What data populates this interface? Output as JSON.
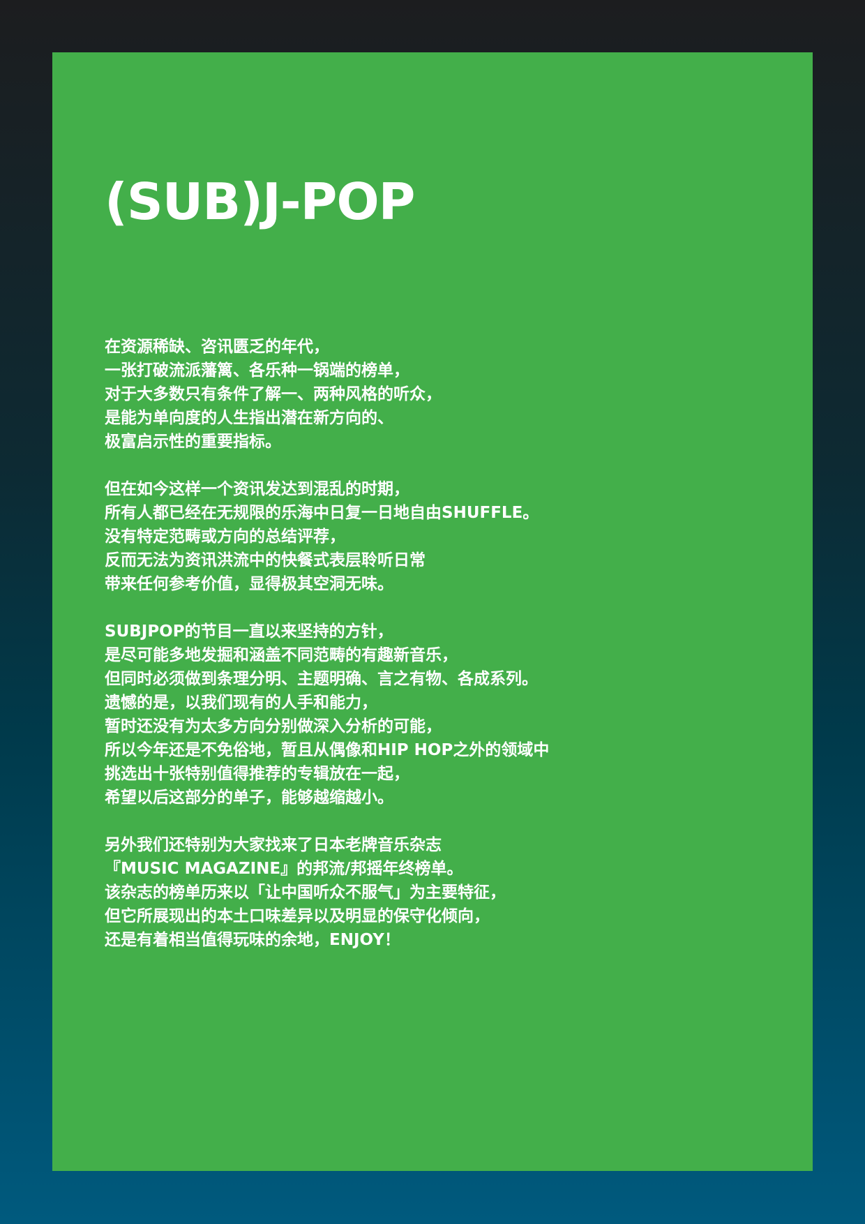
{
  "title": "(SUB)J-POP",
  "paragraphs": [
    {
      "lines": [
        "在资源稀缺、咨讯匮乏的年代，",
        "一张打破流派藩篱、各乐种一锅端的榜单，",
        "对于大多数只有条件了解一、两种风格的听众，",
        "是能为单向度的人生指出潜在新方向的、",
        "极富启示性的重要指标。"
      ]
    },
    {
      "lines": [
        "但在如今这样一个资讯发达到混乱的时期，",
        "所有人都已经在无规限的乐海中日复一日地自由SHUFFLE。",
        "没有特定范畴或方向的总结评荐，",
        "反而无法为资讯洪流中的快餐式表层聆听日常",
        "带来任何参考价值，显得极其空洞无味。"
      ]
    },
    {
      "lines": [
        "SUBJPOP的节目一直以来坚持的方针，",
        "是尽可能多地发掘和涵盖不同范畴的有趣新音乐，",
        "但同时必须做到条理分明、主题明确、言之有物、各成系列。",
        "遗憾的是，以我们现有的人手和能力，",
        "暂时还没有为太多方向分别做深入分析的可能，",
        "所以今年还是不免俗地，暂且从偶像和HIP HOP之外的领域中",
        "挑选出十张特别值得推荐的专辑放在一起，",
        "希望以后这部分的单子，能够越缩越小。"
      ]
    },
    {
      "lines": [
        "另外我们还特别为大家找来了日本老牌音乐杂志",
        "『MUSIC MAGAZINE』的邦流/邦摇年终榜单。",
        "该杂志的榜单历来以「让中国听众不服气」为主要特征，",
        "但它所展现出的本土口味差异以及明显的保守化倾向，",
        "还是有着相当值得玩味的余地，ENJOY！"
      ]
    }
  ],
  "colors": {
    "panel": "#43af4a",
    "text": "#ffffff"
  }
}
